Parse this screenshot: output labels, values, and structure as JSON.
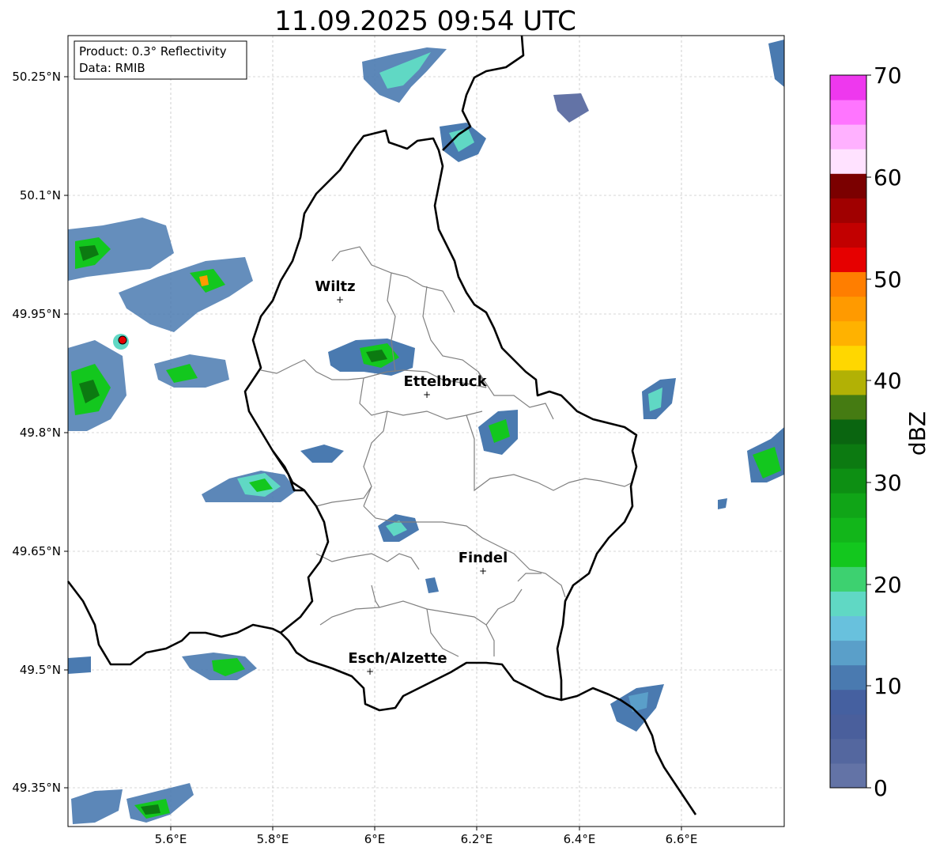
{
  "title": "11.09.2025 09:54 UTC",
  "info_box": {
    "product": "Product: 0.3° Reflectivity",
    "source": "Data: RMIB"
  },
  "axes": {
    "x_ticks": [
      "5.6°E",
      "5.8°E",
      "6°E",
      "6.2°E",
      "6.4°E",
      "6.6°E"
    ],
    "y_ticks": [
      "50.25°N",
      "50.1°N",
      "49.95°N",
      "49.8°N",
      "49.65°N",
      "49.5°N",
      "49.35°N"
    ]
  },
  "cities": [
    {
      "name": "Wiltz"
    },
    {
      "name": "Ettelbruck"
    },
    {
      "name": "Findel"
    },
    {
      "name": "Esch/Alzette"
    }
  ],
  "colorbar": {
    "label": "dBZ",
    "ticks": [
      "0",
      "10",
      "20",
      "30",
      "40",
      "50",
      "60",
      "70"
    ],
    "colors": [
      "#6373a6",
      "#54679f",
      "#4a5f9c",
      "#4560a0",
      "#4a7ab0",
      "#5a9fc9",
      "#68c1dd",
      "#60d8c4",
      "#3dd170",
      "#13c71e",
      "#12b61a",
      "#10a517",
      "#0d8f13",
      "#0c7a11",
      "#0a6510",
      "#457b12",
      "#b2b105",
      "#ffd700",
      "#ffb200",
      "#ff9a00",
      "#ff7e00",
      "#e60000",
      "#c20000",
      "#a00000",
      "#7b0000",
      "#ffe2ff",
      "#ffb1ff",
      "#ff75ff",
      "#ee38ee"
    ]
  }
}
